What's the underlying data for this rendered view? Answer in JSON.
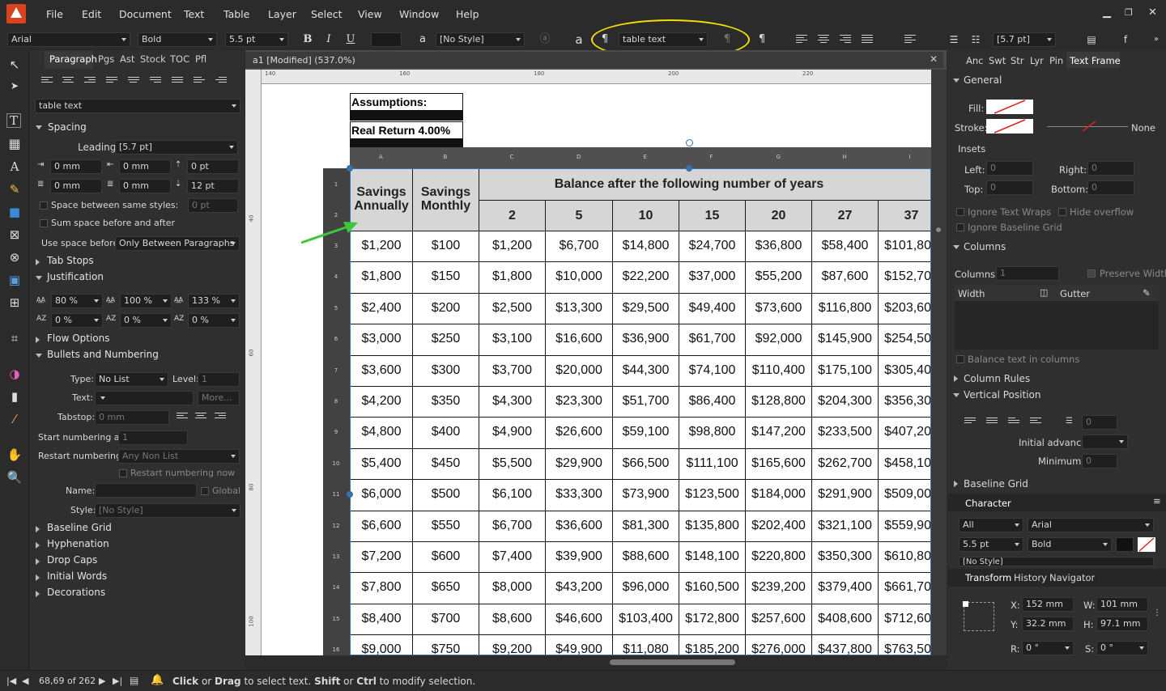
{
  "menu": [
    "File",
    "Edit",
    "Document",
    "Text",
    "Table",
    "Layer",
    "Select",
    "View",
    "Window",
    "Help"
  ],
  "toolbar": {
    "font": "Arial",
    "weight": "Bold",
    "size": "5.5 pt",
    "bold": "B",
    "italic": "I",
    "underline": "U",
    "char_style": "[No Style]",
    "para_style": "table text",
    "leading": "[5.7 pt]"
  },
  "left_panel": {
    "tabs": [
      "Paragraph",
      "Pgs",
      "Ast",
      "Stock",
      "TOC",
      "Pfl"
    ],
    "style": "table text",
    "spacing": "Spacing",
    "leading_label": "Leading:",
    "leading": "[5.7 pt]",
    "indent_left": "0 mm",
    "indent_right": "0 mm",
    "space_before": "0 pt",
    "indent_first": "0 mm",
    "indent_last": "0 mm",
    "space_after": "12 pt",
    "space_between": "Space between same styles:",
    "space_between_val": "0 pt",
    "sum_space": "Sum space before and after",
    "use_space_label": "Use space before:",
    "use_space": "Only Between Paragraphs",
    "tab_stops": "Tab Stops",
    "justification": "Justification",
    "j1": "80 %",
    "j2": "100 %",
    "j3": "133 %",
    "j4": "0 %",
    "j5": "0 %",
    "j6": "0 %",
    "flow": "Flow Options",
    "bullets": "Bullets and Numbering",
    "type_label": "Type:",
    "type": "No List",
    "level_label": "Level:",
    "level": "1",
    "text_label": "Text:",
    "more": "More...",
    "tabstop_label": "Tabstop:",
    "tabstop": "0 mm",
    "start_label": "Start numbering at:",
    "start": "1",
    "restart_label": "Restart numbering:",
    "restart": "Any Non List",
    "restart_now": "Restart numbering now",
    "name_label": "Name:",
    "global": "Global",
    "style_label": "Style:",
    "style_val": "[No Style]",
    "baseline": "Baseline Grid",
    "hyphenation": "Hyphenation",
    "drop_caps": "Drop Caps",
    "initial_words": "Initial Words",
    "decorations": "Decorations"
  },
  "document": {
    "tab_title": "a1 [Modified] (537.0%)",
    "ruler_unit": "mm",
    "ruler_h": [
      "140",
      "160",
      "180",
      "200",
      "220"
    ],
    "ruler_v": [
      "40",
      "60",
      "80",
      "100"
    ],
    "assumptions": "Assumptions:",
    "real_return": "Real Return 4.00%",
    "col_letters": [
      "A",
      "B",
      "C",
      "D",
      "E",
      "F",
      "G",
      "H",
      "I"
    ],
    "row_numbers": [
      "1",
      "2",
      "3",
      "4",
      "5",
      "6",
      "7",
      "8",
      "9",
      "10",
      "11",
      "12",
      "13",
      "14",
      "15",
      "16"
    ],
    "hdr_savings_annually": "Savings Annually",
    "hdr_savings_monthly": "Savings Monthly",
    "hdr_balance": "Balance after the following number of years",
    "years": [
      "2",
      "5",
      "10",
      "15",
      "20",
      "27",
      "37"
    ],
    "rows": [
      [
        "$1,200",
        "$100",
        "$1,200",
        "$6,700",
        "$14,800",
        "$24,700",
        "$36,800",
        "$58,400",
        "$101,800"
      ],
      [
        "$1,800",
        "$150",
        "$1,800",
        "$10,000",
        "$22,200",
        "$37,000",
        "$55,200",
        "$87,600",
        "$152,700"
      ],
      [
        "$2,400",
        "$200",
        "$2,500",
        "$13,300",
        "$29,500",
        "$49,400",
        "$73,600",
        "$116,800",
        "$203,600"
      ],
      [
        "$3,000",
        "$250",
        "$3,100",
        "$16,600",
        "$36,900",
        "$61,700",
        "$92,000",
        "$145,900",
        "$254,500"
      ],
      [
        "$3,600",
        "$300",
        "$3,700",
        "$20,000",
        "$44,300",
        "$74,100",
        "$110,400",
        "$175,100",
        "$305,400"
      ],
      [
        "$4,200",
        "$350",
        "$4,300",
        "$23,300",
        "$51,700",
        "$86,400",
        "$128,800",
        "$204,300",
        "$356,300"
      ],
      [
        "$4,800",
        "$400",
        "$4,900",
        "$26,600",
        "$59,100",
        "$98,800",
        "$147,200",
        "$233,500",
        "$407,200"
      ],
      [
        "$5,400",
        "$450",
        "$5,500",
        "$29,900",
        "$66,500",
        "$111,100",
        "$165,600",
        "$262,700",
        "$458,100"
      ],
      [
        "$6,000",
        "$500",
        "$6,100",
        "$33,300",
        "$73,900",
        "$123,500",
        "$184,000",
        "$291,900",
        "$509,000"
      ],
      [
        "$6,600",
        "$550",
        "$6,700",
        "$36,600",
        "$81,300",
        "$135,800",
        "$202,400",
        "$321,100",
        "$559,900"
      ],
      [
        "$7,200",
        "$600",
        "$7,400",
        "$39,900",
        "$88,600",
        "$148,100",
        "$220,800",
        "$350,300",
        "$610,800"
      ],
      [
        "$7,800",
        "$650",
        "$8,000",
        "$43,200",
        "$96,000",
        "$160,500",
        "$239,200",
        "$379,400",
        "$661,700"
      ],
      [
        "$8,400",
        "$700",
        "$8,600",
        "$46,600",
        "$103,400",
        "$172,800",
        "$257,600",
        "$408,600",
        "$712,600"
      ],
      [
        "$9,000",
        "$750",
        "$9,200",
        "$49,900",
        "$11,080",
        "$185,200",
        "$276,000",
        "$437,800",
        "$763,500"
      ]
    ]
  },
  "right_panel": {
    "tabs": [
      "Anc",
      "Swt",
      "Str",
      "Lyr",
      "Pin",
      "Text Frame"
    ],
    "general": "General",
    "fill": "Fill:",
    "stroke": "Stroke:",
    "none": "None",
    "insets": "Insets",
    "left": "Left:",
    "right": "Right:",
    "top": "Top:",
    "bottom": "Bottom:",
    "zero": "0",
    "ignore_wraps": "Ignore Text Wraps",
    "hide_overflow": "Hide overflow",
    "ignore_baseline": "Ignore Baseline Grid",
    "columns": "Columns",
    "columns_label": "Columns:",
    "columns_val": "1",
    "preserve": "Preserve Width",
    "width": "Width",
    "gutter": "Gutter",
    "balance": "Balance text in columns",
    "column_rules": "Column Rules",
    "vertical_position": "Vertical Position",
    "initial_advance": "Initial advance:",
    "minimum": "Minimum:",
    "baseline_grid": "Baseline Grid",
    "character": "Character",
    "char_all": "All",
    "char_font": "Arial",
    "char_size": "5.5 pt",
    "char_weight": "Bold",
    "char_style": "[No Style]",
    "transform_tabs": [
      "Transform",
      "History",
      "Navigator"
    ],
    "x_label": "X:",
    "x": "152 mm",
    "y_label": "Y:",
    "y": "32.2 mm",
    "w_label": "W:",
    "w": "101 mm",
    "h_label": "H:",
    "h": "97.1 mm",
    "r_label": "R:",
    "r": "0 °",
    "s_label": "S:",
    "s": "0 °"
  },
  "status": {
    "pages": "68,69 of 262",
    "click": "Click",
    "or1": " or ",
    "drag": "Drag",
    "mid": " to select text. ",
    "shift": "Shift",
    "or2": " or ",
    "ctrl": "Ctrl",
    "end": " to modify selection."
  },
  "colors": {
    "accent": "#d9431e",
    "highlight": "#f0e100",
    "arrow": "#3ec63e",
    "selection": "#3a6fb0"
  }
}
